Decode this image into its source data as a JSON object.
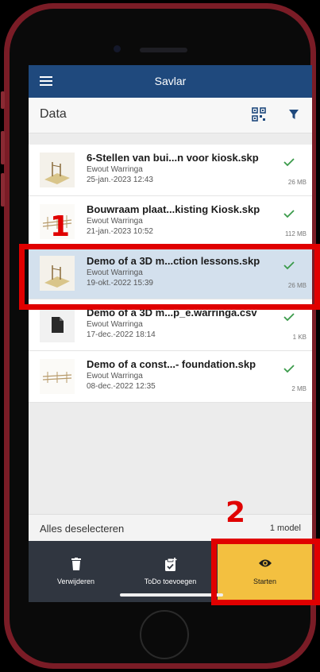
{
  "app": {
    "title": "Savlar"
  },
  "subheader": {
    "label": "Data"
  },
  "files": [
    {
      "name": "6-Stellen van bui...n voor kiosk.skp",
      "author": "Ewout Warringa",
      "date": "25-jan.-2023 12:43",
      "size": "26 MB",
      "thumb": "model-thumbnail",
      "selected": false
    },
    {
      "name": "Bouwraam plaat...kisting Kiosk.skp",
      "author": "Ewout Warringa",
      "date": "21-jan.-2023 10:52",
      "size": "112 MB",
      "thumb": "frame-thumbnail",
      "selected": false
    },
    {
      "name": "Demo of a 3D m...ction lessons.skp",
      "author": "Ewout Warringa",
      "date": "19-okt.-2022 15:39",
      "size": "26 MB",
      "thumb": "model-thumbnail",
      "selected": true
    },
    {
      "name": "Demo of a 3D m...p_e.warringa.csv",
      "author": "Ewout Warringa",
      "date": "17-dec.-2022 18:14",
      "size": "1 KB",
      "thumb": "document-icon",
      "selected": false
    },
    {
      "name": "Demo of a const...- foundation.skp",
      "author": "Ewout Warringa",
      "date": "08-dec.-2022 12:35",
      "size": "2 MB",
      "thumb": "frame-thumbnail",
      "selected": false
    }
  ],
  "footer": {
    "deselect_label": "Alles deselecteren",
    "count": "1 model"
  },
  "toolbar": {
    "delete_label": "Verwijderen",
    "todo_label": "ToDo toevoegen",
    "start_label": "Starten"
  },
  "annotations": {
    "marker1": "1",
    "marker2": "2"
  },
  "colors": {
    "appbar": "#1f497d",
    "selected_row": "#d3e0ed",
    "check": "#3a9a4a",
    "start_button": "#f3c040",
    "toolbar": "#303640",
    "highlight": "#e00000",
    "phone_frame": "#7a1c26"
  }
}
